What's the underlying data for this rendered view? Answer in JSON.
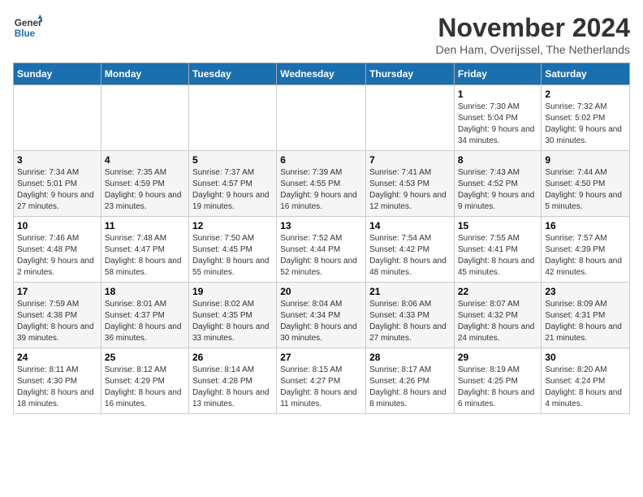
{
  "logo": {
    "line1": "General",
    "line2": "Blue"
  },
  "title": "November 2024",
  "subtitle": "Den Ham, Overijssel, The Netherlands",
  "weekdays": [
    "Sunday",
    "Monday",
    "Tuesday",
    "Wednesday",
    "Thursday",
    "Friday",
    "Saturday"
  ],
  "weeks": [
    [
      {
        "day": "",
        "info": ""
      },
      {
        "day": "",
        "info": ""
      },
      {
        "day": "",
        "info": ""
      },
      {
        "day": "",
        "info": ""
      },
      {
        "day": "",
        "info": ""
      },
      {
        "day": "1",
        "info": "Sunrise: 7:30 AM\nSunset: 5:04 PM\nDaylight: 9 hours and 34 minutes."
      },
      {
        "day": "2",
        "info": "Sunrise: 7:32 AM\nSunset: 5:02 PM\nDaylight: 9 hours and 30 minutes."
      }
    ],
    [
      {
        "day": "3",
        "info": "Sunrise: 7:34 AM\nSunset: 5:01 PM\nDaylight: 9 hours and 27 minutes."
      },
      {
        "day": "4",
        "info": "Sunrise: 7:35 AM\nSunset: 4:59 PM\nDaylight: 9 hours and 23 minutes."
      },
      {
        "day": "5",
        "info": "Sunrise: 7:37 AM\nSunset: 4:57 PM\nDaylight: 9 hours and 19 minutes."
      },
      {
        "day": "6",
        "info": "Sunrise: 7:39 AM\nSunset: 4:55 PM\nDaylight: 9 hours and 16 minutes."
      },
      {
        "day": "7",
        "info": "Sunrise: 7:41 AM\nSunset: 4:53 PM\nDaylight: 9 hours and 12 minutes."
      },
      {
        "day": "8",
        "info": "Sunrise: 7:43 AM\nSunset: 4:52 PM\nDaylight: 9 hours and 9 minutes."
      },
      {
        "day": "9",
        "info": "Sunrise: 7:44 AM\nSunset: 4:50 PM\nDaylight: 9 hours and 5 minutes."
      }
    ],
    [
      {
        "day": "10",
        "info": "Sunrise: 7:46 AM\nSunset: 4:48 PM\nDaylight: 9 hours and 2 minutes."
      },
      {
        "day": "11",
        "info": "Sunrise: 7:48 AM\nSunset: 4:47 PM\nDaylight: 8 hours and 58 minutes."
      },
      {
        "day": "12",
        "info": "Sunrise: 7:50 AM\nSunset: 4:45 PM\nDaylight: 8 hours and 55 minutes."
      },
      {
        "day": "13",
        "info": "Sunrise: 7:52 AM\nSunset: 4:44 PM\nDaylight: 8 hours and 52 minutes."
      },
      {
        "day": "14",
        "info": "Sunrise: 7:54 AM\nSunset: 4:42 PM\nDaylight: 8 hours and 48 minutes."
      },
      {
        "day": "15",
        "info": "Sunrise: 7:55 AM\nSunset: 4:41 PM\nDaylight: 8 hours and 45 minutes."
      },
      {
        "day": "16",
        "info": "Sunrise: 7:57 AM\nSunset: 4:39 PM\nDaylight: 8 hours and 42 minutes."
      }
    ],
    [
      {
        "day": "17",
        "info": "Sunrise: 7:59 AM\nSunset: 4:38 PM\nDaylight: 8 hours and 39 minutes."
      },
      {
        "day": "18",
        "info": "Sunrise: 8:01 AM\nSunset: 4:37 PM\nDaylight: 8 hours and 36 minutes."
      },
      {
        "day": "19",
        "info": "Sunrise: 8:02 AM\nSunset: 4:35 PM\nDaylight: 8 hours and 33 minutes."
      },
      {
        "day": "20",
        "info": "Sunrise: 8:04 AM\nSunset: 4:34 PM\nDaylight: 8 hours and 30 minutes."
      },
      {
        "day": "21",
        "info": "Sunrise: 8:06 AM\nSunset: 4:33 PM\nDaylight: 8 hours and 27 minutes."
      },
      {
        "day": "22",
        "info": "Sunrise: 8:07 AM\nSunset: 4:32 PM\nDaylight: 8 hours and 24 minutes."
      },
      {
        "day": "23",
        "info": "Sunrise: 8:09 AM\nSunset: 4:31 PM\nDaylight: 8 hours and 21 minutes."
      }
    ],
    [
      {
        "day": "24",
        "info": "Sunrise: 8:11 AM\nSunset: 4:30 PM\nDaylight: 8 hours and 18 minutes."
      },
      {
        "day": "25",
        "info": "Sunrise: 8:12 AM\nSunset: 4:29 PM\nDaylight: 8 hours and 16 minutes."
      },
      {
        "day": "26",
        "info": "Sunrise: 8:14 AM\nSunset: 4:28 PM\nDaylight: 8 hours and 13 minutes."
      },
      {
        "day": "27",
        "info": "Sunrise: 8:15 AM\nSunset: 4:27 PM\nDaylight: 8 hours and 11 minutes."
      },
      {
        "day": "28",
        "info": "Sunrise: 8:17 AM\nSunset: 4:26 PM\nDaylight: 8 hours and 8 minutes."
      },
      {
        "day": "29",
        "info": "Sunrise: 8:19 AM\nSunset: 4:25 PM\nDaylight: 8 hours and 6 minutes."
      },
      {
        "day": "30",
        "info": "Sunrise: 8:20 AM\nSunset: 4:24 PM\nDaylight: 8 hours and 4 minutes."
      }
    ]
  ]
}
